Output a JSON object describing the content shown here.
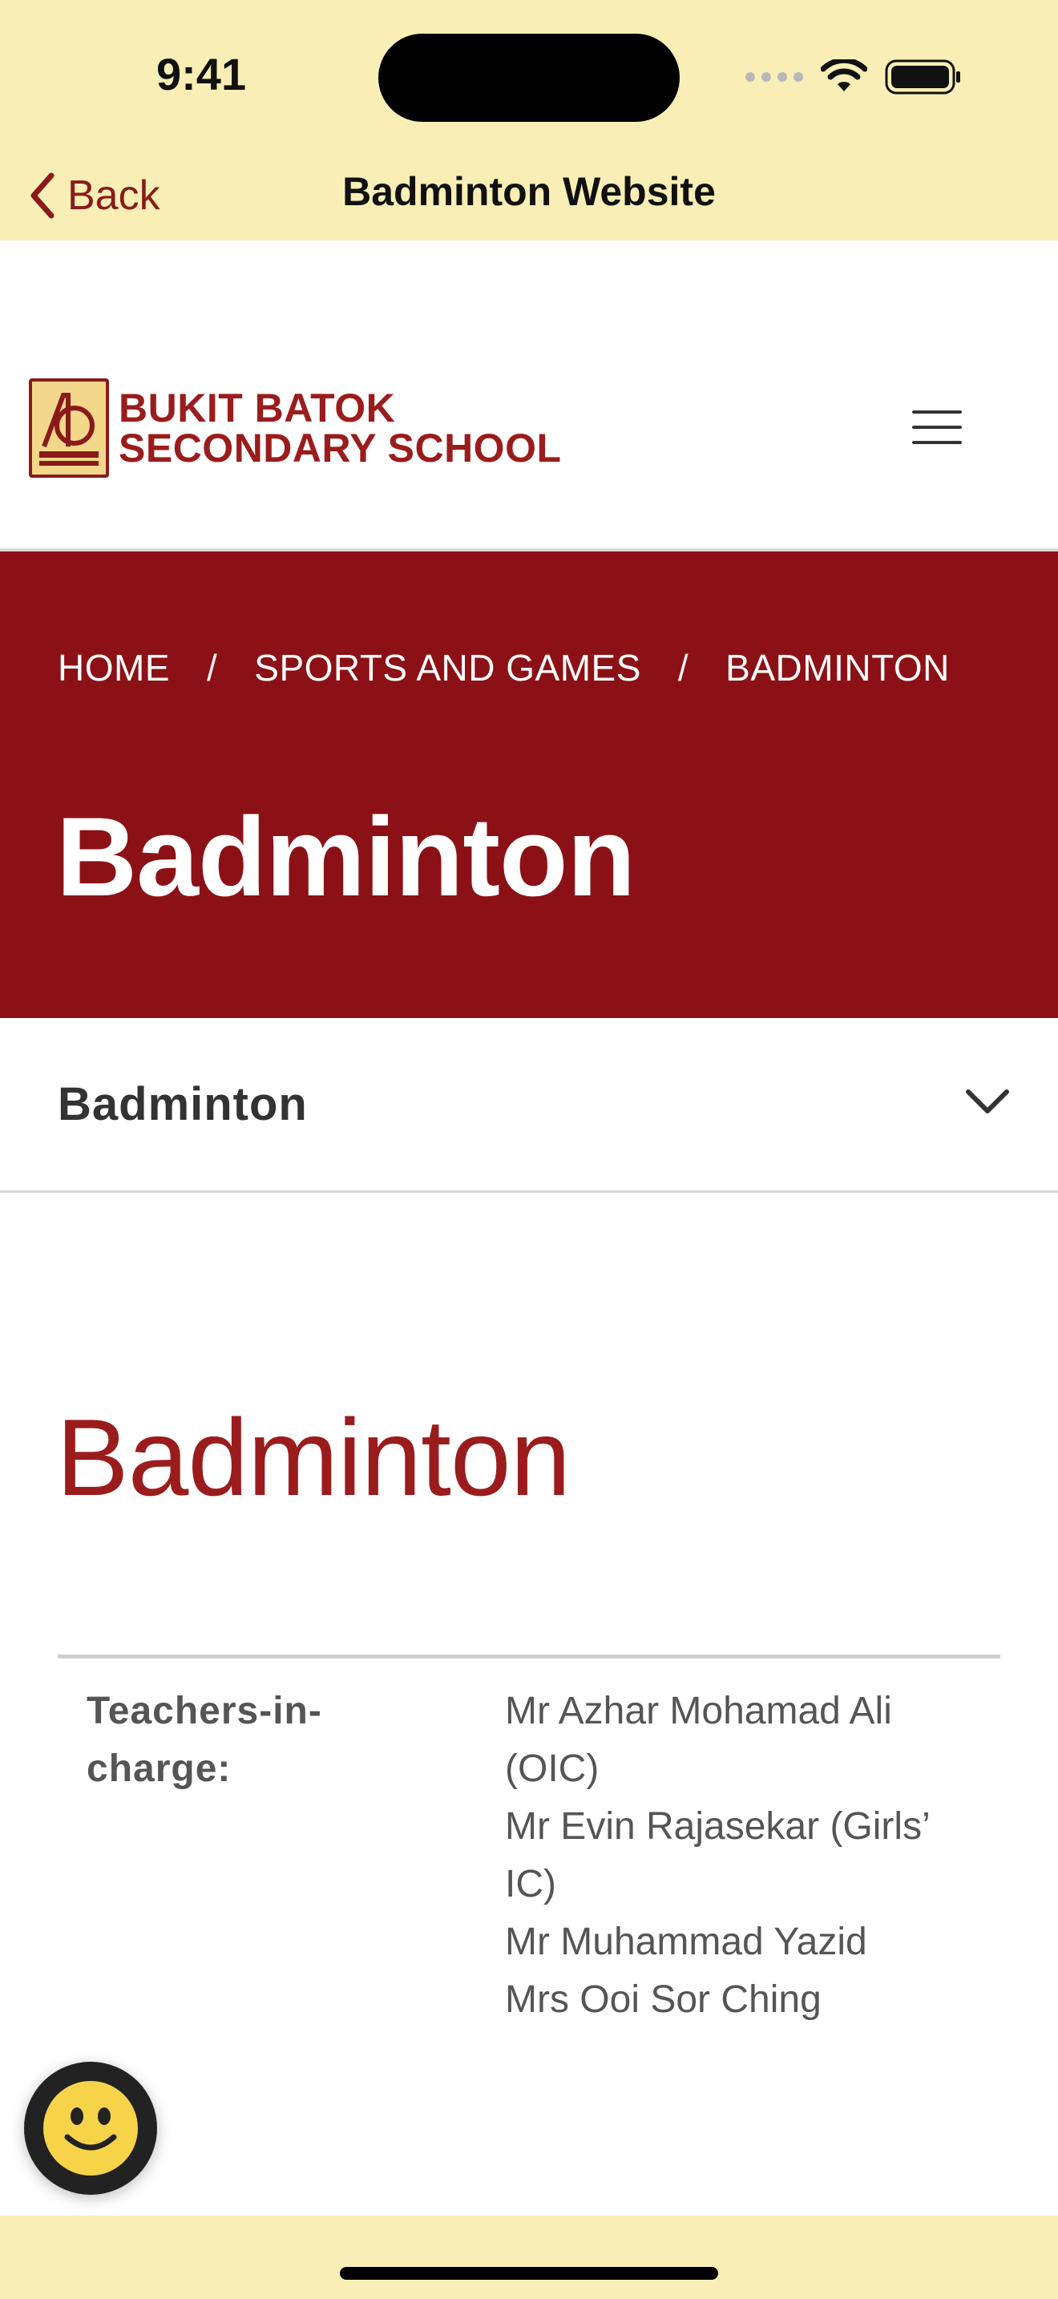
{
  "status_bar": {
    "time": "9:41"
  },
  "nav_bar": {
    "back_label": "Back",
    "title": "Badminton Website"
  },
  "site_header": {
    "logo_line1": "BUKIT BATOK",
    "logo_line2": "SECONDARY SCHOOL",
    "menu_icon": "hamburger-icon"
  },
  "hero": {
    "breadcrumb": [
      "HOME",
      "SPORTS AND GAMES",
      "BADMINTON"
    ],
    "separator": "/",
    "title": "Badminton"
  },
  "accordion": {
    "label": "Badminton",
    "icon": "chevron-down-icon"
  },
  "content": {
    "title": "Badminton",
    "info": {
      "label": "Teachers-in-charge:",
      "values": [
        "Mr Azhar Mohamad Ali (OIC)",
        "Mr Evin Rajasekar (Girls’ IC)",
        "Mr Muhammad Yazid",
        "Mrs Ooi Sor Ching"
      ]
    }
  },
  "colors": {
    "app_bar_bg": "#f9efb6",
    "brand_red": "#8c1116",
    "title_red": "#9b1c1c",
    "text_gray": "#555555"
  }
}
